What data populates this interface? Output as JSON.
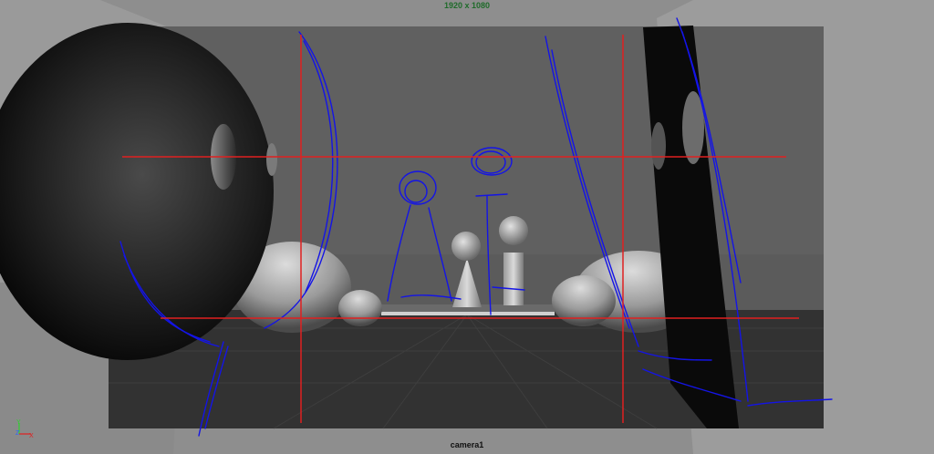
{
  "viewport": {
    "resolution_label": "1920 x 1080",
    "camera_label": "camera1"
  },
  "axis_gizmo": {
    "y": "Y",
    "z": "Z",
    "x": "X"
  },
  "colors": {
    "grid_lines": "#e02020",
    "sketch_strokes": "#1414e6",
    "gate_background": "#5a5a5a",
    "ground": "#333333"
  }
}
